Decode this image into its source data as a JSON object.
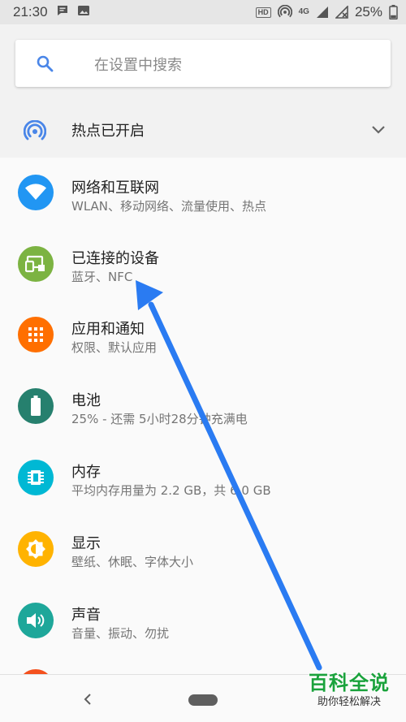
{
  "status_bar": {
    "time": "21:30",
    "hd_badge": "HD",
    "network_type": "4G",
    "battery_percent": "25%",
    "icons": [
      "message-icon",
      "image-icon",
      "hd-voice-icon",
      "hotspot-icon",
      "signal-icon",
      "wifi-off-icon",
      "battery-icon"
    ]
  },
  "search": {
    "placeholder": "在设置中搜索",
    "icon": "search-icon",
    "icon_color": "#4a86e8"
  },
  "hotspot_banner": {
    "label": "热点已开启",
    "icon": "hotspot-icon",
    "expand_icon": "chevron-down-icon",
    "icon_color": "#4a86e8"
  },
  "settings": [
    {
      "id": "network",
      "title": "网络和互联网",
      "subtitle": "WLAN、移动网络、流量使用、热点",
      "icon": "wifi-icon",
      "color": "#2196f3"
    },
    {
      "id": "connected-devices",
      "title": "已连接的设备",
      "subtitle": "蓝牙、NFC",
      "icon": "connected-devices-icon",
      "color": "#7cb342"
    },
    {
      "id": "apps",
      "title": "应用和通知",
      "subtitle": "权限、默认应用",
      "icon": "apps-icon",
      "color": "#ff6f00"
    },
    {
      "id": "battery",
      "title": "电池",
      "subtitle": "25% - 还需 5小时28分钟充满电",
      "icon": "battery-icon",
      "color": "#26806e"
    },
    {
      "id": "storage",
      "title": "内存",
      "subtitle": "平均内存用量为 2.2 GB，共 6.0 GB",
      "icon": "memory-icon",
      "color": "#00b8d4"
    },
    {
      "id": "display",
      "title": "显示",
      "subtitle": "壁纸、休眠、字体大小",
      "icon": "brightness-icon",
      "color": "#ffb300"
    },
    {
      "id": "sound",
      "title": "声音",
      "subtitle": "音量、振动、勿扰",
      "icon": "volume-icon",
      "color": "#1ea79a"
    }
  ],
  "nav_bar": {
    "back_icon": "back-icon",
    "home_icon": "home-pill-icon"
  },
  "watermark": {
    "title": "百科全说",
    "subtitle": "助你轻松解决"
  },
  "annotation": {
    "type": "arrow",
    "color": "#2a7bf2",
    "points_to": "connected-devices"
  }
}
